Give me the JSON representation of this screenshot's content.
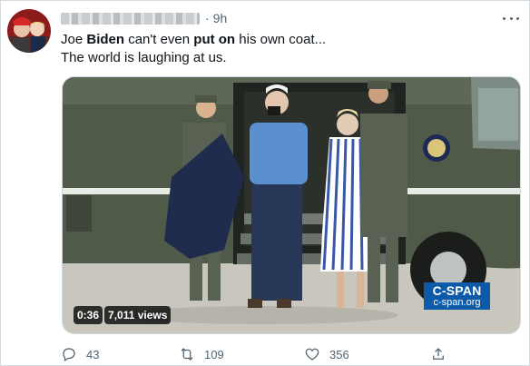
{
  "tweet": {
    "time": "9h",
    "separator": "·",
    "text_line1": {
      "p1": "Joe ",
      "b1": "Biden",
      "p2": " can't even ",
      "b2": "put on",
      "p3": " his own coat..."
    },
    "text_line2": "The world is laughing at us."
  },
  "media": {
    "watermark_brand": "C-SPAN",
    "watermark_url": "c-span.org",
    "duration": "0:36",
    "views": "7,011 views"
  },
  "actions": {
    "replies": "43",
    "retweets": "109",
    "likes": "356"
  },
  "icons": [
    "more-icon",
    "reply-icon",
    "retweet-icon",
    "like-icon",
    "share-icon",
    "presidential-seal-icon"
  ],
  "colors": {
    "cspan_blue": "#0d5aa8",
    "secondary_text": "#536471",
    "helicopter_green": "#4f5a49"
  }
}
